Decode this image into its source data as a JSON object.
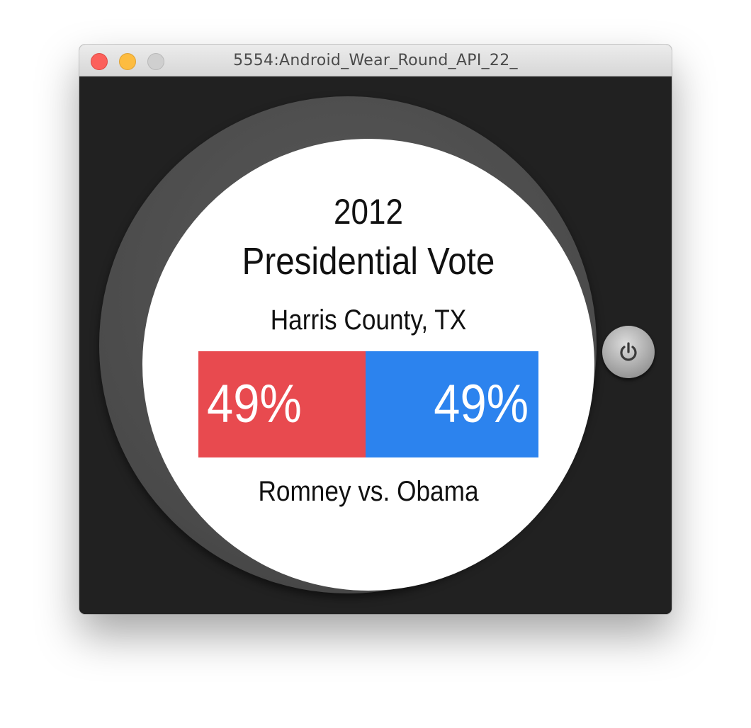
{
  "window": {
    "title": "5554:Android_Wear_Round_API_22_"
  },
  "watch": {
    "year": "2012",
    "heading": "Presidential Vote",
    "county": "Harris County, TX",
    "matchup": "Romney vs. Obama",
    "results": [
      {
        "candidate": "Romney",
        "label": "49%",
        "share": 0.49,
        "color": "#e84a4f"
      },
      {
        "candidate": "Obama",
        "label": "49%",
        "share": 0.49,
        "color": "#2c83ee"
      }
    ],
    "power_icon": "power-icon"
  },
  "colors": {
    "romney": "#e84a4f",
    "obama": "#2c83ee",
    "bezel": "#4a4a4a",
    "background": "#212121"
  }
}
